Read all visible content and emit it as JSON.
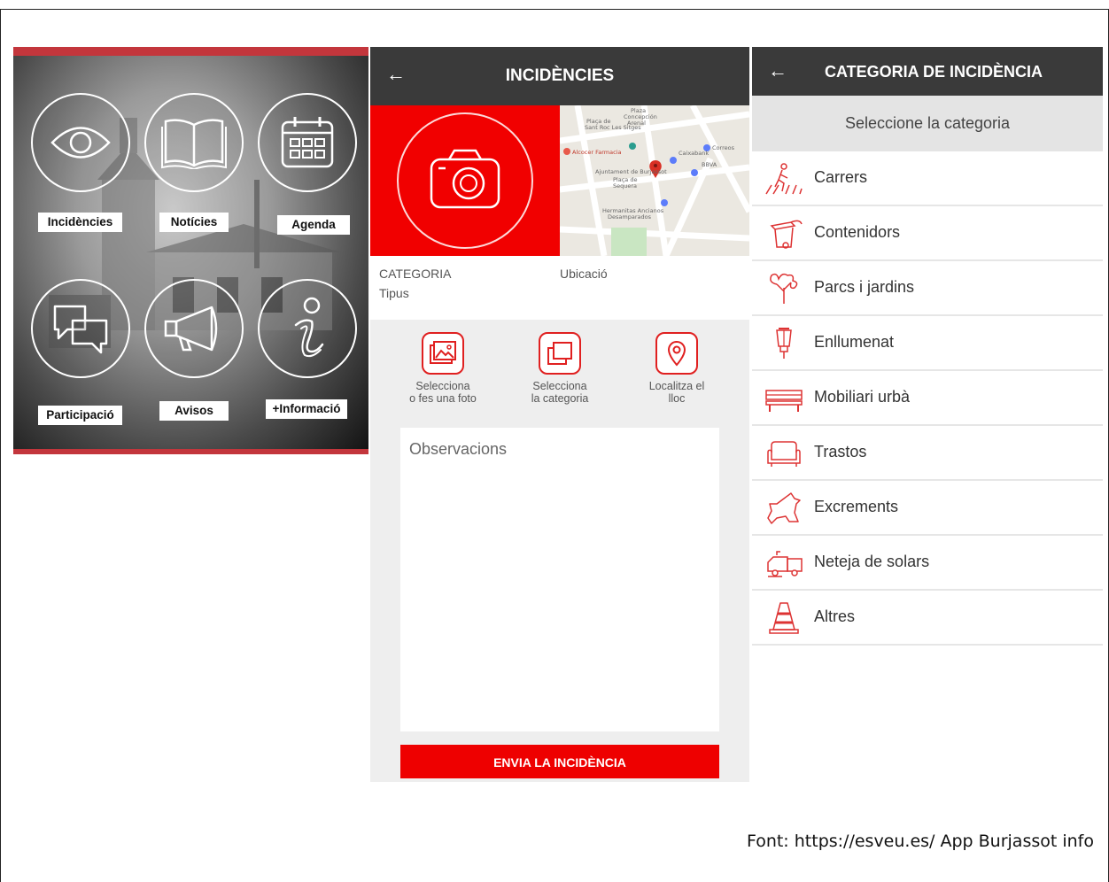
{
  "home": {
    "items": [
      {
        "label": "Incidències",
        "icon": "eye-icon"
      },
      {
        "label": "Notícies",
        "icon": "book-icon"
      },
      {
        "label": "Agenda",
        "icon": "calendar-icon"
      },
      {
        "label": "Participació",
        "icon": "chat-icon"
      },
      {
        "label": "Avisos",
        "icon": "megaphone-icon"
      },
      {
        "label": "+Informació",
        "icon": "info-icon"
      }
    ],
    "accent": "#c3363c"
  },
  "incidencies": {
    "title": "INCIDÈNCIES",
    "back": "←",
    "category_label": "CATEGORIA",
    "type_label": "Tipus",
    "location_label": "Ubicació",
    "map_labels": [
      "Plaza",
      "Concepción",
      "Arenal",
      "Plaça de",
      "Sant Roc Les Sitges",
      "Alcocer Farmacia",
      "Correos",
      "Caixabank",
      "BBVA",
      "Ajuntament de Burjassot",
      "Plaça de",
      "Sequera",
      "Hermanitas Ancianos",
      "Desamparados"
    ],
    "actions": [
      {
        "label_1": "Selecciona",
        "label_2": "o fes una foto",
        "icon": "image-icon"
      },
      {
        "label_1": "Selecciona",
        "label_2": "la categoria",
        "icon": "layers-icon"
      },
      {
        "label_1": "Localitza el",
        "label_2": "lloc",
        "icon": "location-pin-icon"
      }
    ],
    "observations_placeholder": "Observacions",
    "submit_label": "ENVIA LA INCIDÈNCIA",
    "accent": "#ee0000"
  },
  "categories": {
    "title": "CATEGORIA DE INCIDÈNCIA",
    "back": "←",
    "subtitle": "Seleccione la categoria",
    "items": [
      {
        "label": "Carrers",
        "icon": "pedestrian-crossing-icon"
      },
      {
        "label": "Contenidors",
        "icon": "trash-container-icon"
      },
      {
        "label": "Parcs i jardins",
        "icon": "tree-icon"
      },
      {
        "label": "Enllumenat",
        "icon": "street-lamp-icon"
      },
      {
        "label": "Mobiliari urbà",
        "icon": "bench-icon"
      },
      {
        "label": "Trastos",
        "icon": "sofa-icon"
      },
      {
        "label": "Excrements",
        "icon": "dog-icon"
      },
      {
        "label": "Neteja de solars",
        "icon": "cleaning-truck-icon"
      },
      {
        "label": "Altres",
        "icon": "traffic-cone-icon"
      }
    ]
  },
  "source": "Font: https://esveu.es/ App Burjassot info"
}
